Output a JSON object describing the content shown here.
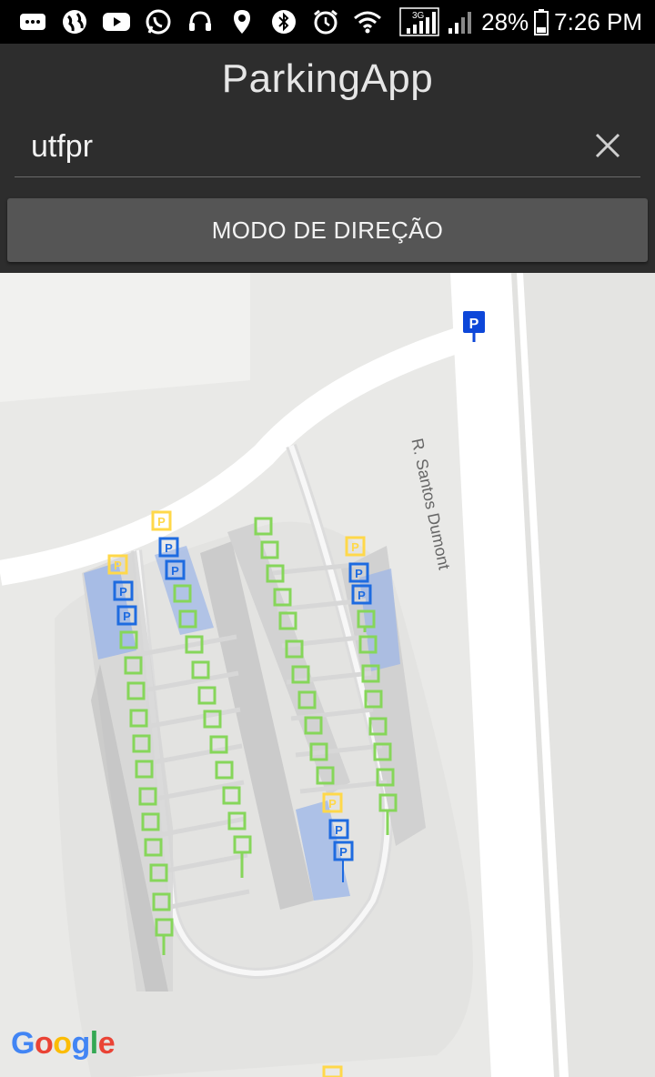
{
  "status_bar": {
    "battery": "28%",
    "time": "7:26 PM",
    "network": "3G"
  },
  "app": {
    "title": "ParkingApp"
  },
  "search": {
    "value": "utfpr"
  },
  "mode_button": {
    "label": "MODO DE DIREÇÃO"
  },
  "map": {
    "street_label": "R. Santos Dumont",
    "logo": {
      "g": "G",
      "o1": "o",
      "o2": "o",
      "g2": "g",
      "l": "l",
      "e": "e"
    },
    "spot_colors": {
      "available": "#86d65a",
      "reserved": "#ffd84a",
      "occupied": "#1e6be0"
    }
  }
}
